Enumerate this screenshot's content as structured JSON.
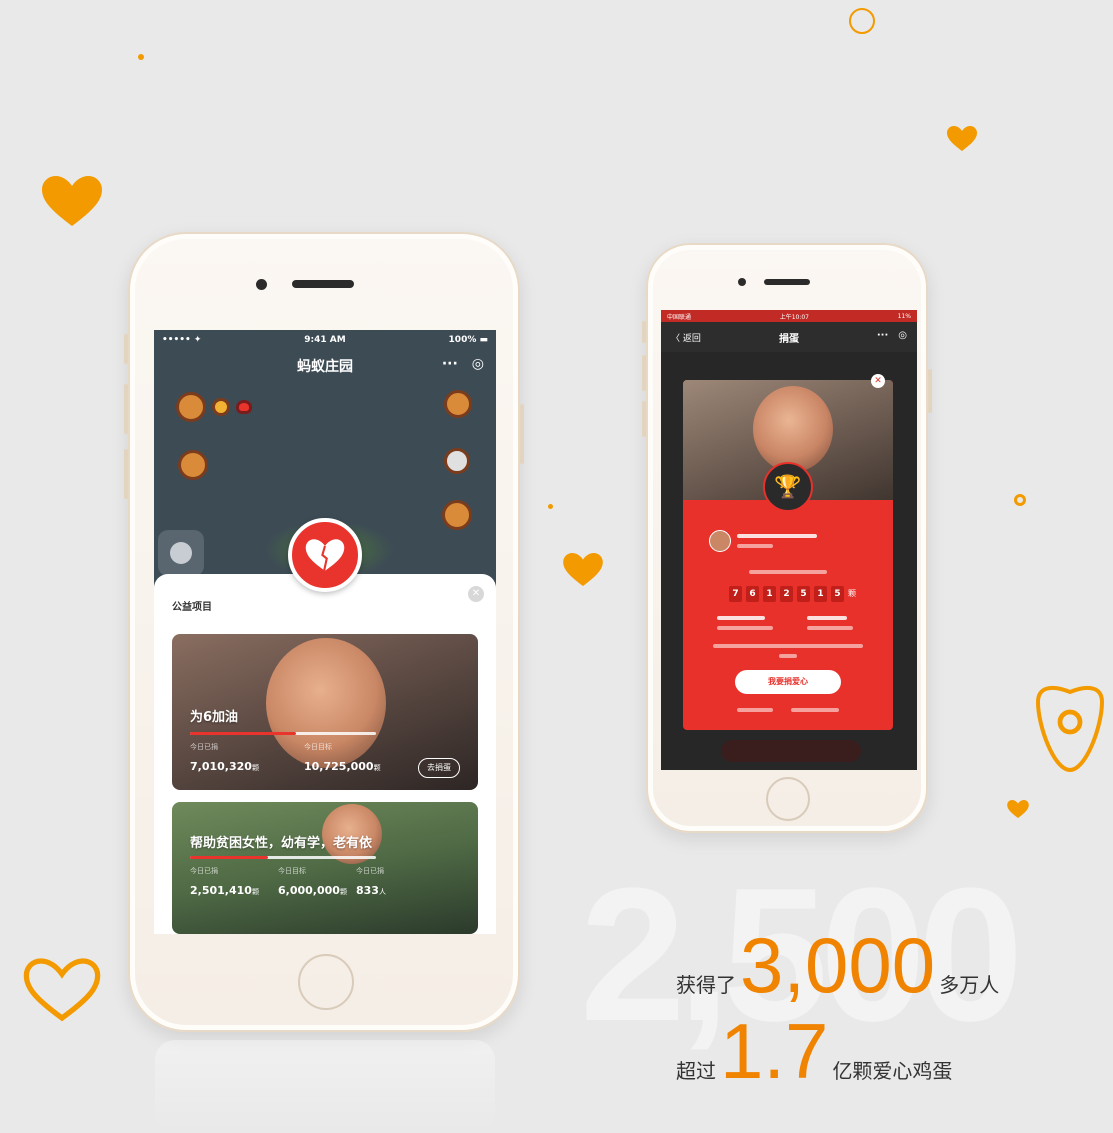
{
  "decor": {
    "accent_color": "#f39a00",
    "stat_color": "#f08300",
    "icons": [
      "heart-icon",
      "heart-outline-icon",
      "tooth-outline-icon",
      "circle-outline-icon",
      "dot-icon"
    ]
  },
  "phone_left": {
    "status_bar": {
      "carrier": "••••• ✦",
      "time": "9:41 AM",
      "battery": "100% ▬"
    },
    "nav": {
      "title": "蚂蚁庄园",
      "more": "···",
      "target": "◎"
    },
    "panel": {
      "title": "公益项目",
      "close": "✕",
      "projects": [
        {
          "title": "为6加油",
          "progress": 0.57,
          "label_a": "今日已捐",
          "value_a": "7,010,320",
          "unit_a": "颗",
          "label_b": "今日目标",
          "value_b": "10,725,000",
          "unit_b": "颗",
          "button": "去捐蛋"
        },
        {
          "title": "帮助贫困女性，幼有学，老有依",
          "progress": 0.42,
          "label_a": "今日已捐",
          "value_a": "2,501,410",
          "unit_a": "颗",
          "label_b": "今日目标",
          "value_b": "6,000,000",
          "unit_b": "颗",
          "label_c": "今日已捐",
          "value_c": "833",
          "unit_c": "人"
        }
      ]
    }
  },
  "phone_right": {
    "status_bar": {
      "carrier": "中国联通",
      "time": "上午10:07",
      "battery": "11%"
    },
    "nav": {
      "back": "〈 返回",
      "title": "捐蛋",
      "more": "···",
      "target": "◎"
    },
    "modal": {
      "close": "✕",
      "digits": [
        "7",
        "6",
        "1",
        "2",
        "5",
        "1",
        "5"
      ],
      "digits_unit": "颗",
      "cta": "我要捐爱心"
    }
  },
  "stats": {
    "bg_number": "2,500",
    "line1_prefix": "获得了",
    "line1_number": "3,000",
    "line1_suffix": "多万人",
    "line2_prefix": "超过",
    "line2_number": "1.7",
    "line2_suffix": "亿颗爱心鸡蛋"
  }
}
